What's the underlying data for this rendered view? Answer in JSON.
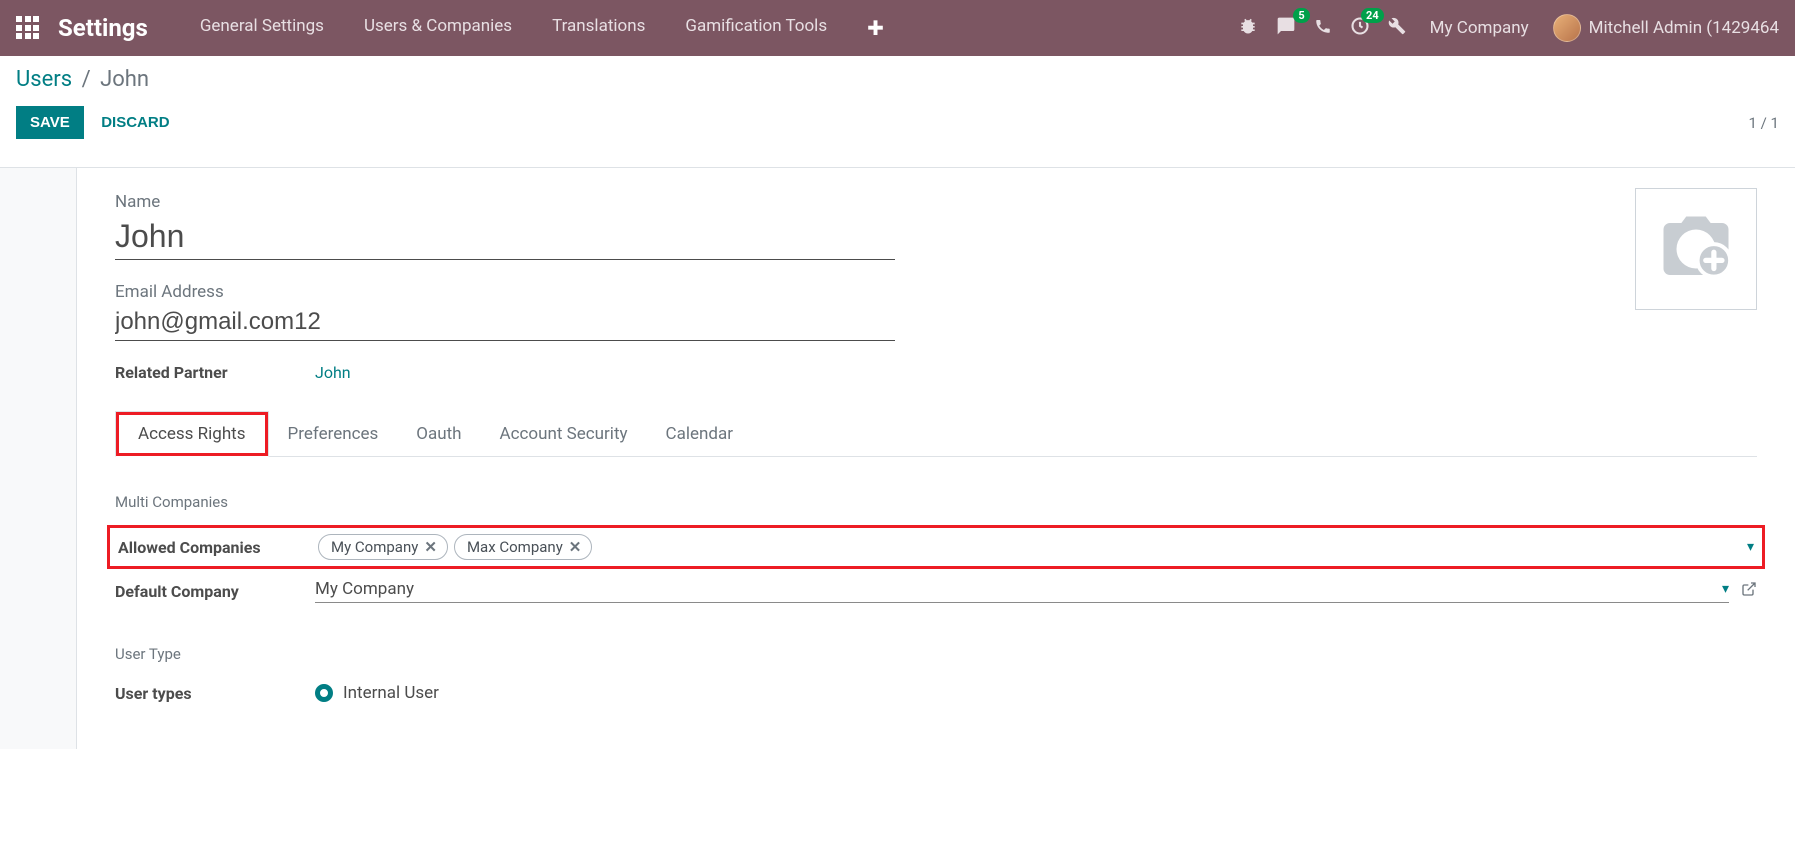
{
  "nav": {
    "app_title": "Settings",
    "items": [
      "General Settings",
      "Users & Companies",
      "Translations",
      "Gamification Tools"
    ],
    "badges": {
      "messages": "5",
      "activities": "24"
    },
    "company": "My Company",
    "user": "Mitchell Admin (1429464"
  },
  "breadcrumb": {
    "root": "Users",
    "current": "John"
  },
  "actions": {
    "save": "SAVE",
    "discard": "DISCARD"
  },
  "pager": "1 / 1",
  "form": {
    "name_label": "Name",
    "name_value": "John",
    "email_label": "Email Address",
    "email_value": "john@gmail.com12",
    "related_label": "Related Partner",
    "related_value": "John"
  },
  "tabs": [
    "Access Rights",
    "Preferences",
    "Oauth",
    "Account Security",
    "Calendar"
  ],
  "multi": {
    "section": "Multi Companies",
    "allowed_label": "Allowed Companies",
    "tags": [
      "My Company",
      "Max Company"
    ],
    "default_label": "Default Company",
    "default_value": "My Company"
  },
  "usertype": {
    "section": "User Type",
    "label": "User types",
    "value": "Internal User"
  }
}
